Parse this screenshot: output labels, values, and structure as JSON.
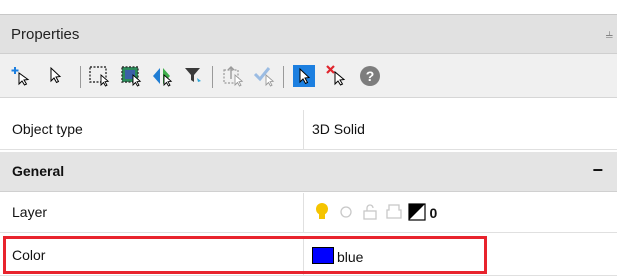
{
  "panel": {
    "title": "Properties",
    "pin_glyph": "⫨"
  },
  "toolbar": {
    "icons": [
      "add-selected-icon",
      "select-objects-icon",
      "window-select-icon",
      "crossing-select-icon",
      "toggle-pickadd-icon",
      "quick-select-icon",
      "inherit-icon",
      "filter-select-icon",
      "highlight-select-icon",
      "clear-select-icon",
      "help-icon"
    ]
  },
  "rows": {
    "object_type": {
      "label": "Object type",
      "value": "3D Solid"
    },
    "general": {
      "label": "General",
      "collapse": "−"
    },
    "layer": {
      "label": "Layer",
      "value": "0"
    },
    "color": {
      "label": "Color",
      "value": "blue",
      "swatch": "#0000ff"
    }
  },
  "colors": {
    "highlight": "#e8232d",
    "header_bg": "#e1e1e1",
    "section_bg": "#e4e4e4"
  }
}
